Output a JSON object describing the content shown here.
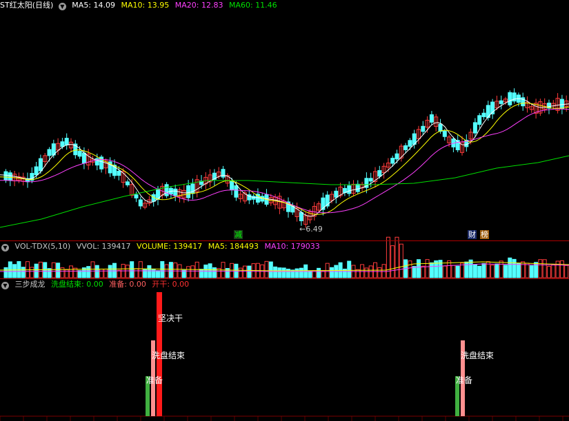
{
  "main_panel": {
    "title": "ST红太阳(日线)",
    "ma": [
      {
        "label": "MA5: 14.09",
        "color": "#ffffff"
      },
      {
        "label": "MA10: 13.95",
        "color": "#ffff00"
      },
      {
        "label": "MA20: 12.83",
        "color": "#ff40ff"
      },
      {
        "label": "MA60: 11.46",
        "color": "#00e000"
      }
    ],
    "low_label": "←6.49",
    "tag_reduce": "减",
    "tag_finance": "财",
    "tag_rank": "榜"
  },
  "volume_panel": {
    "indicator": "VOL-TDX(5,10)",
    "vvol": "VVOL: 139417",
    "volume": "VOLUME: 139417",
    "ma5": "MA5: 184493",
    "ma10": "MA10: 179033"
  },
  "signal_panel": {
    "indicator": "三步成龙",
    "wash_end": "洗盘结束: 0.00",
    "prepare": "准备: 0.00",
    "start": "开干: 0.00",
    "labels": {
      "go": "坚决干",
      "wash": "洗盘结束",
      "ready": "准备"
    }
  },
  "colors": {
    "up": "#ff3c3c",
    "down": "#54ffff",
    "ma5": "#ffffff",
    "ma10": "#ffff00",
    "ma20": "#ff40ff",
    "ma60": "#00e000"
  }
}
